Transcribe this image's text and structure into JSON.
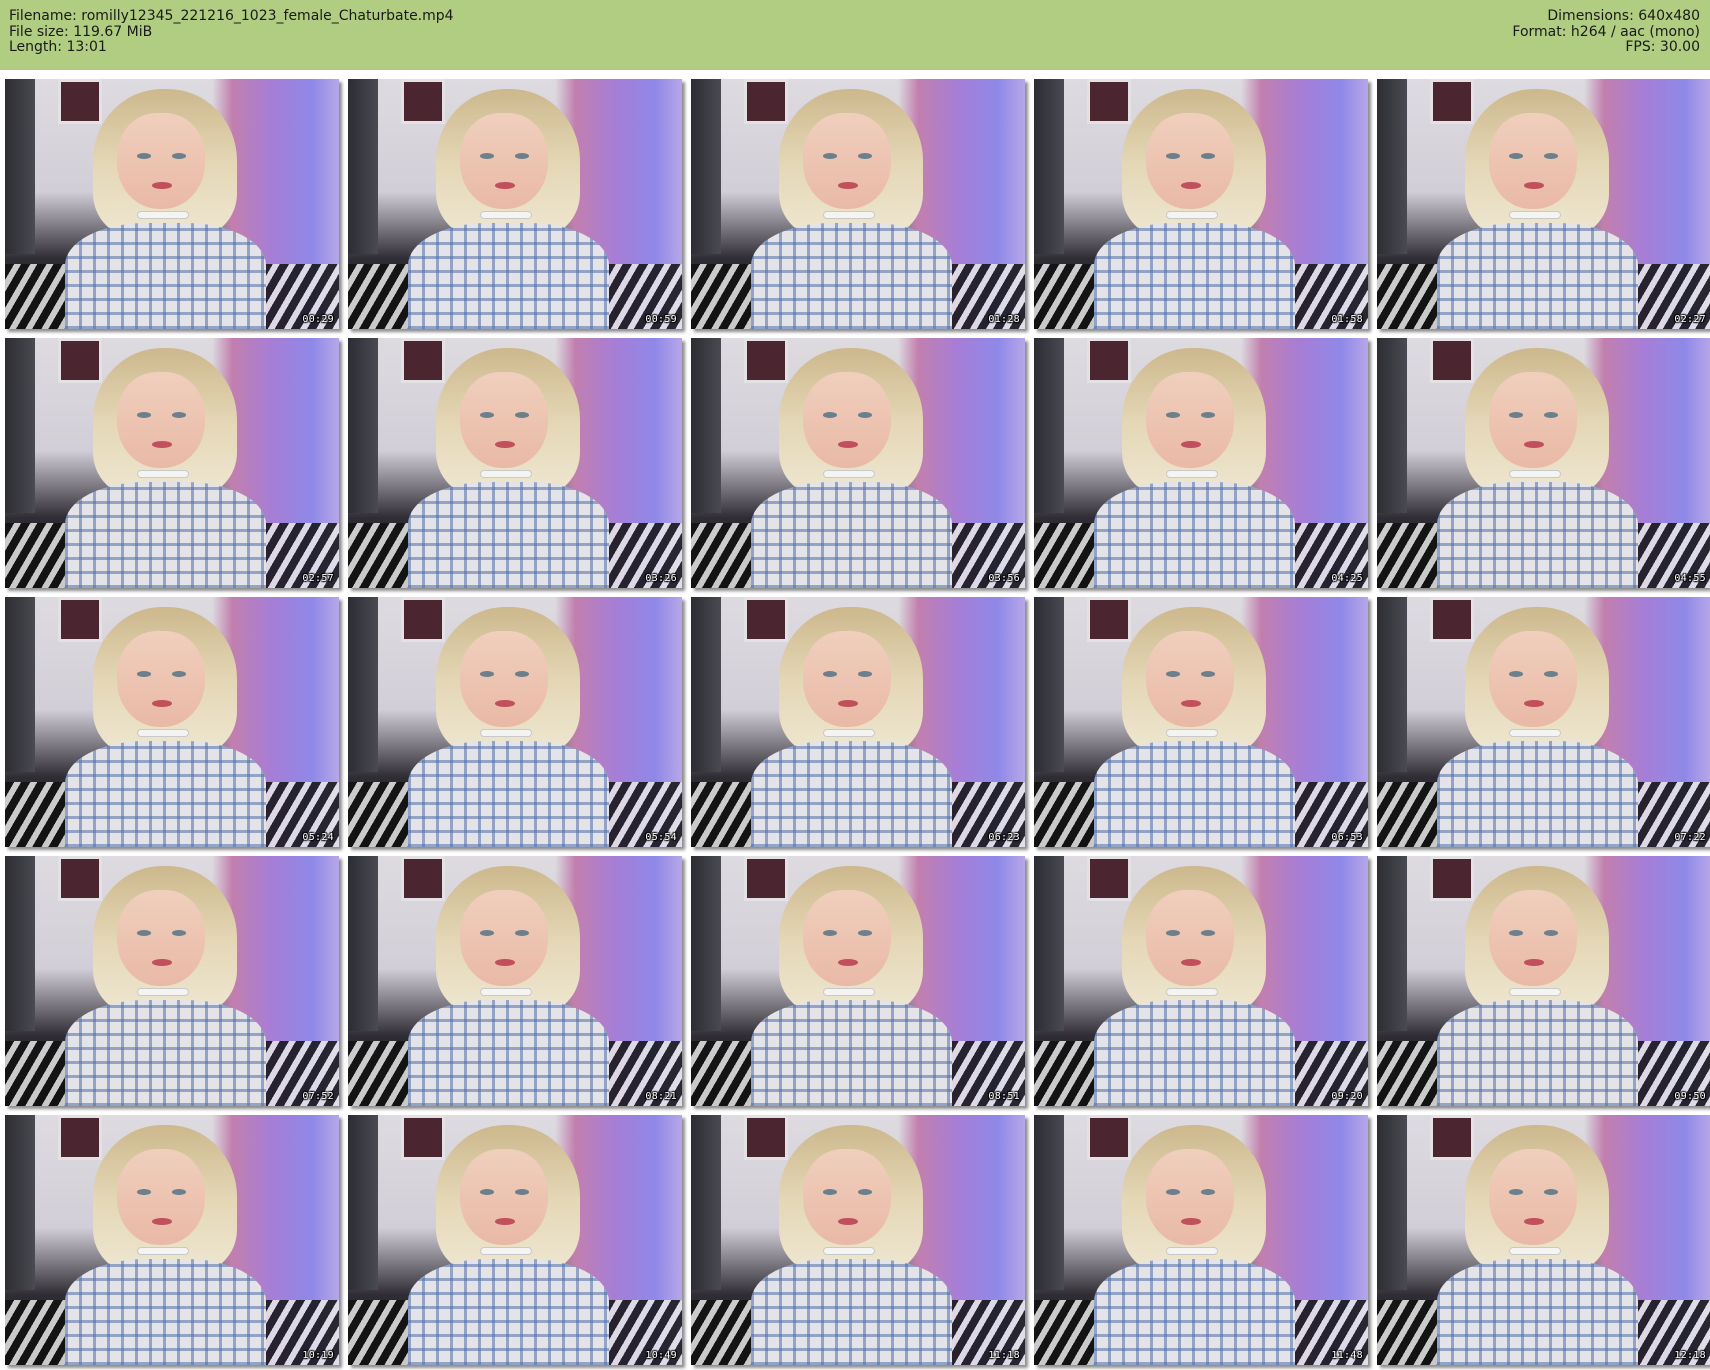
{
  "header": {
    "filename": "Filename: romilly12345_221216_1023_female_Chaturbate.mp4",
    "file_size": "File size: 119.67 MiB",
    "length": "Length: 13:01",
    "dimensions": "Dimensions: 640x480",
    "format": "Format: h264 / aac (mono)",
    "fps": "FPS: 30.00"
  },
  "colors": {
    "header_background": "#b0cd81",
    "page_background": "#ffffff"
  },
  "thumbnails": [
    {
      "time": "00:29"
    },
    {
      "time": "00:59"
    },
    {
      "time": "01:28"
    },
    {
      "time": "01:58"
    },
    {
      "time": "02:27"
    },
    {
      "time": "02:57"
    },
    {
      "time": "03:26"
    },
    {
      "time": "03:56"
    },
    {
      "time": "04:25"
    },
    {
      "time": "04:55"
    },
    {
      "time": "05:24"
    },
    {
      "time": "05:54"
    },
    {
      "time": "06:23"
    },
    {
      "time": "06:53"
    },
    {
      "time": "07:22"
    },
    {
      "time": "07:52"
    },
    {
      "time": "08:21"
    },
    {
      "time": "08:51"
    },
    {
      "time": "09:20"
    },
    {
      "time": "09:50"
    },
    {
      "time": "10:19"
    },
    {
      "time": "10:49"
    },
    {
      "time": "11:18"
    },
    {
      "time": "11:48"
    },
    {
      "time": "12:18"
    }
  ]
}
